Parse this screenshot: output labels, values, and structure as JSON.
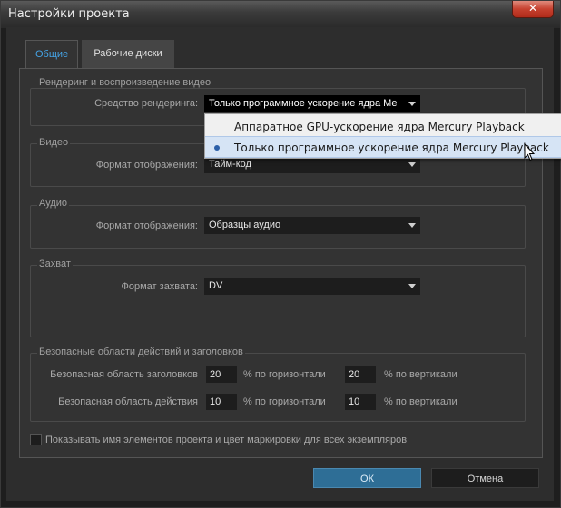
{
  "window": {
    "title": "Настройки проекта",
    "close": "✕"
  },
  "tabs": [
    {
      "label": "Общие",
      "active": true
    },
    {
      "label": "Рабочие диски",
      "active": false
    }
  ],
  "rendering": {
    "group_title": "Рендеринг и воспроизведение видео",
    "label": "Средство рендеринга:",
    "value": "Только программное ускорение ядра Me",
    "options": [
      "Аппаратное GPU-ускорение ядра Mercury Playback (OpenCL)",
      "Только программное ускорение ядра Mercury Playback"
    ],
    "selected_index": 1
  },
  "video": {
    "group_title": "Видео",
    "label": "Формат отображения:",
    "value": "Тайм-код"
  },
  "audio": {
    "group_title": "Аудио",
    "label": "Формат отображения:",
    "value": "Образцы аудио"
  },
  "capture": {
    "group_title": "Захват",
    "label": "Формат захвата:",
    "value": "DV"
  },
  "safe": {
    "group_title": "Безопасные области действий и заголовков",
    "title_label": "Безопасная область заголовков",
    "title_h": "20",
    "title_v": "20",
    "action_label": "Безопасная область действия",
    "action_h": "10",
    "action_v": "10",
    "horizontal_suffix": "% по горизонтали",
    "vertical_suffix": "% по вертикали"
  },
  "checkbox_label": "Показывать имя элементов проекта и цвет маркировки для всех экземпляров",
  "buttons": {
    "ok": "ОК",
    "cancel": "Отмена"
  },
  "colors": {
    "accent": "#45a3e5",
    "ok_button": "#2e6e96",
    "close_button": "#c6412f"
  }
}
